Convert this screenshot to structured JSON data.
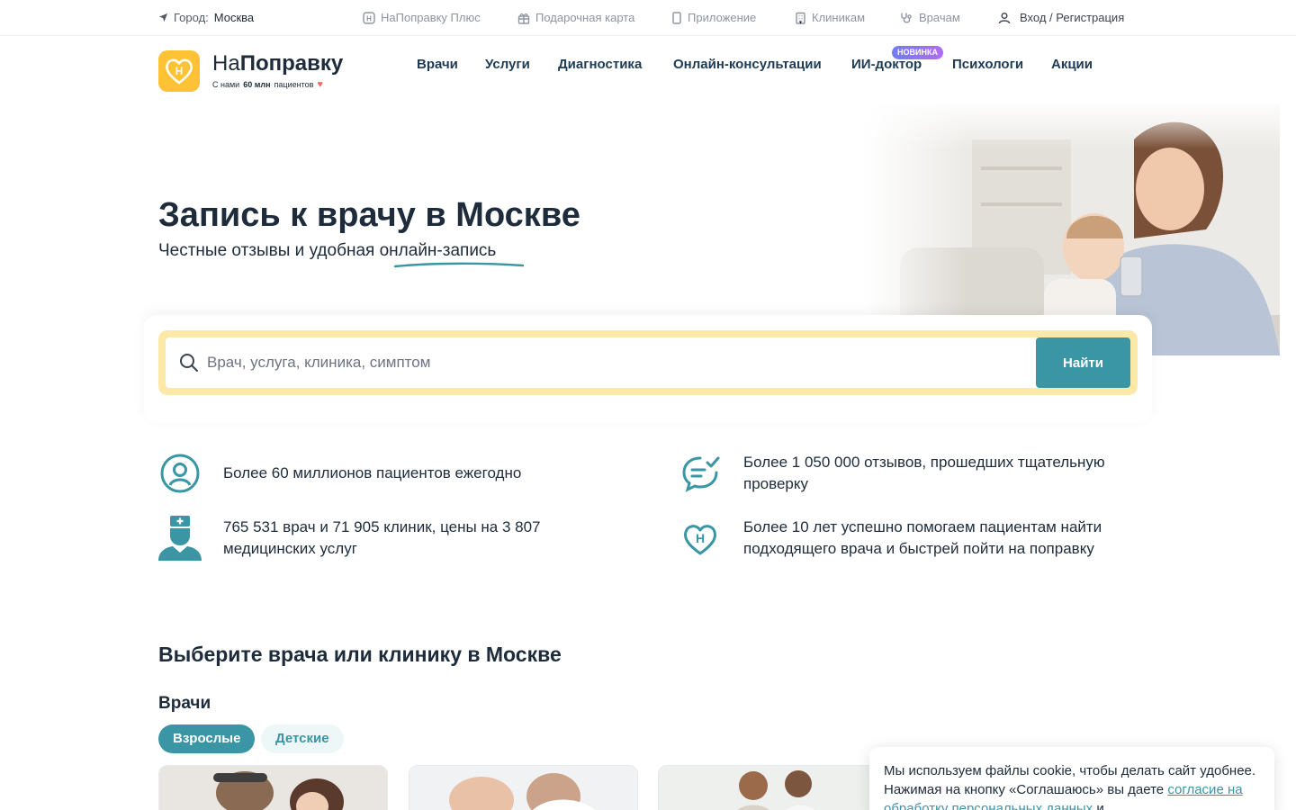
{
  "topbar": {
    "city_label": "Город:",
    "city_value": "Москва",
    "links": [
      {
        "label": "НаПоправку Плюс",
        "icon": "plus-badge-icon"
      },
      {
        "label": "Подарочная карта",
        "icon": "gift-icon"
      },
      {
        "label": "Приложение",
        "icon": "phone-icon"
      },
      {
        "label": "Клиникам",
        "icon": "building-icon"
      },
      {
        "label": "Врачам",
        "icon": "stethoscope-icon"
      }
    ],
    "login": "Вход / Регистрация"
  },
  "header": {
    "logo_prefix": "На",
    "logo_bold": "Поправку",
    "slogan_pre": "С нами",
    "slogan_bold": "60 млн",
    "slogan_post": "пациентов",
    "nav": [
      "Врачи",
      "Услуги",
      "Диагностика",
      "Онлайн-консультации",
      "ИИ-доктор",
      "Психологи",
      "Акции"
    ],
    "badge": "НОВИНКА"
  },
  "hero": {
    "title": "Запись к врачу в Москве",
    "subtitle_pre": "Честные отзывы и удобная",
    "subtitle_hl": "онлайн-запись"
  },
  "search": {
    "placeholder": "Врач, услуга, клиника, симптом",
    "button": "Найти"
  },
  "features": [
    {
      "icon": "patient-icon",
      "text": "Более 60 миллионов пациентов ежегодно"
    },
    {
      "icon": "reviews-icon",
      "text": "Более 1 050 000 отзывов, прошедших тщательную проверку"
    },
    {
      "icon": "doctor-icon",
      "text": "765 531 врач и 71 905 клиник, цены на 3 807 медицинских услуг"
    },
    {
      "icon": "heart-logo-icon",
      "text": "Более 10 лет успешно помогаем пациентам найти подходящего врача и быстрей пойти на поправку"
    }
  ],
  "section": {
    "title": "Выберите врача или клинику в Москве",
    "doctors_title": "Врачи",
    "tabs": [
      "Взрослые",
      "Детские"
    ]
  },
  "cookie": {
    "text_pre": "Мы используем файлы cookie, чтобы делать сайт удобнее. Нажимая на кнопку «Соглашаюсь» вы даете",
    "link": "согласие на обработку персональных данных",
    "text_post": "и"
  },
  "colors": {
    "accent": "#3a95a5",
    "logo_yellow": "#fdc334",
    "search_frame": "#fde9a7",
    "text_dark": "#1d2b3a"
  }
}
